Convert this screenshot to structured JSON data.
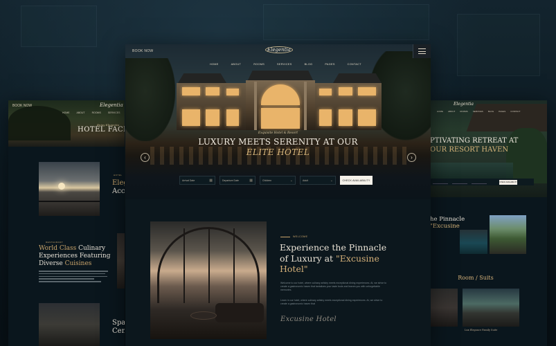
{
  "left_mock": {
    "book_now": "BOOK NOW",
    "logo": "Elegentia",
    "nav": [
      "HOME",
      "ABOUT",
      "ROOMS",
      "SERVICES"
    ],
    "hero_kicker": "Enjoy Elegentia",
    "hero_title": "HOTEL FACILI",
    "section_kicker": "HOTEL",
    "section_title_1": "Eleg",
    "section_title_2": "Acco",
    "dining_kicker": "RESTAURANT",
    "dining_title_1": "World Class",
    "dining_title_2": " Culinary",
    "dining_title_3": "Experiences Featuring",
    "dining_title_4": "Diverse ",
    "dining_title_5": "Cuisines",
    "spa_title_1": "Spa",
    "spa_title_2": "Cent"
  },
  "center_mock": {
    "book_now": "BOOK NOW",
    "logo": "Elegentia",
    "nav": [
      "HOME",
      "ABOUT",
      "ROOMS",
      "SERVICES",
      "BLOG",
      "PAGES",
      "CONTACT"
    ],
    "hero_kicker": "Exquisite Hotel & Resort",
    "hero_title_line1": "LUXURY MEETS SERENITY AT OUR",
    "hero_title_line2": "ELITE HOTEL",
    "prev_arrow": "‹",
    "next_arrow": "›",
    "booking": {
      "arrival": "Arrival Date",
      "departure": "Departure Date",
      "children": "Children",
      "adult": "Adult",
      "button": "CHECK AVAILABILITY"
    },
    "welcome_kicker": "WELCOME",
    "about_title_1": "Experience the Pinnacle",
    "about_title_2": "of Luxury at ",
    "about_title_3": "\"Excusine",
    "about_title_4": "Hotel\"",
    "about_paragraph_1": "Welcome to our hotel, where culinary artistry meets exceptional dining experiences. At, we strive to create a gastronomic haven that tantalizes your taste buds and leaves you with unforgettable memories.",
    "about_paragraph_2": "Learn in our hotel, where culinary artistry meets exceptional dining experiences. At, we strive to create a gastronomic haven that",
    "signature": "Excusine Hotel"
  },
  "right_mock": {
    "logo": "Elegentia",
    "nav": [
      "HOME",
      "ABOUT",
      "ROOMS",
      "SERVICES",
      "BLOG",
      "PAGES",
      "CONTACT"
    ],
    "hero_line1": "PTIVATING RETREAT AT",
    "hero_line2": "OUR RESORT HAVEN",
    "check_button": "CHECK AVAILABILITY",
    "pinnacle_line1": "he Pinnacle",
    "pinnacle_line2": "\"Excusine",
    "rooms_title": "Room / Suits",
    "room_caption": "Lux Elegance Family Suite"
  },
  "colors": {
    "accent_gold": "#c9a46b",
    "background": "#0b1a22"
  }
}
